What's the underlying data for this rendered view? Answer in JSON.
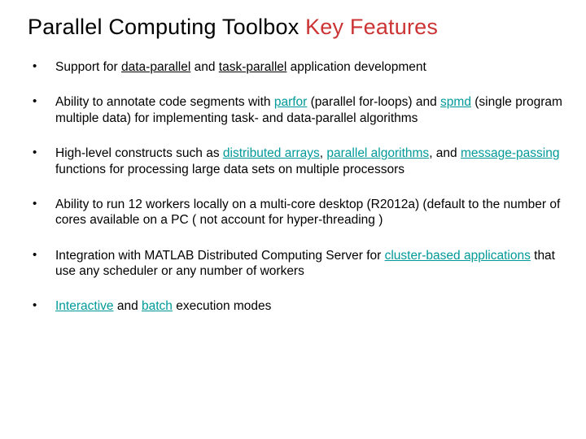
{
  "title": {
    "plain": "Parallel Computing Toolbox ",
    "accent": "Key Features"
  },
  "bullets": [
    {
      "segments": [
        {
          "t": "Support for "
        },
        {
          "t": "data-parallel",
          "u": true
        },
        {
          "t": " and "
        },
        {
          "t": "task-parallel",
          "u": true
        },
        {
          "t": " application development"
        }
      ]
    },
    {
      "segments": [
        {
          "t": "Ability to annotate code segments with "
        },
        {
          "t": "parfor",
          "u": true,
          "hl": true
        },
        {
          "t": " (parallel for-loops) and "
        },
        {
          "t": "spmd",
          "u": true,
          "hl": true
        },
        {
          "t": " (single program multiple data) for implementing task- and data-parallel algorithms"
        }
      ]
    },
    {
      "segments": [
        {
          "t": "High-level constructs such as "
        },
        {
          "t": "distributed arrays",
          "u": true,
          "hl": true
        },
        {
          "t": ", "
        },
        {
          "t": "parallel algorithms",
          "u": true,
          "hl": true
        },
        {
          "t": ", and "
        },
        {
          "t": "message-passing",
          "u": true,
          "hl": true
        },
        {
          "t": " functions for processing large data sets on multiple processors"
        }
      ]
    },
    {
      "segments": [
        {
          "t": "Ability to run 12 workers locally on a multi-core desktop (R2012a)\n(default to the number of cores available on a PC ( not account for hyper-threading )"
        }
      ]
    },
    {
      "segments": [
        {
          "t": "Integration with MATLAB Distributed Computing Server for "
        },
        {
          "t": "cluster-based applications",
          "u": true,
          "hl": true
        },
        {
          "t": " that use any scheduler or any number of workers"
        }
      ]
    },
    {
      "segments": [
        {
          "t": "Interactive",
          "u": true,
          "hl": true
        },
        {
          "t": " and "
        },
        {
          "t": "batch",
          "u": true,
          "hl": true
        },
        {
          "t": " execution modes"
        }
      ]
    }
  ]
}
